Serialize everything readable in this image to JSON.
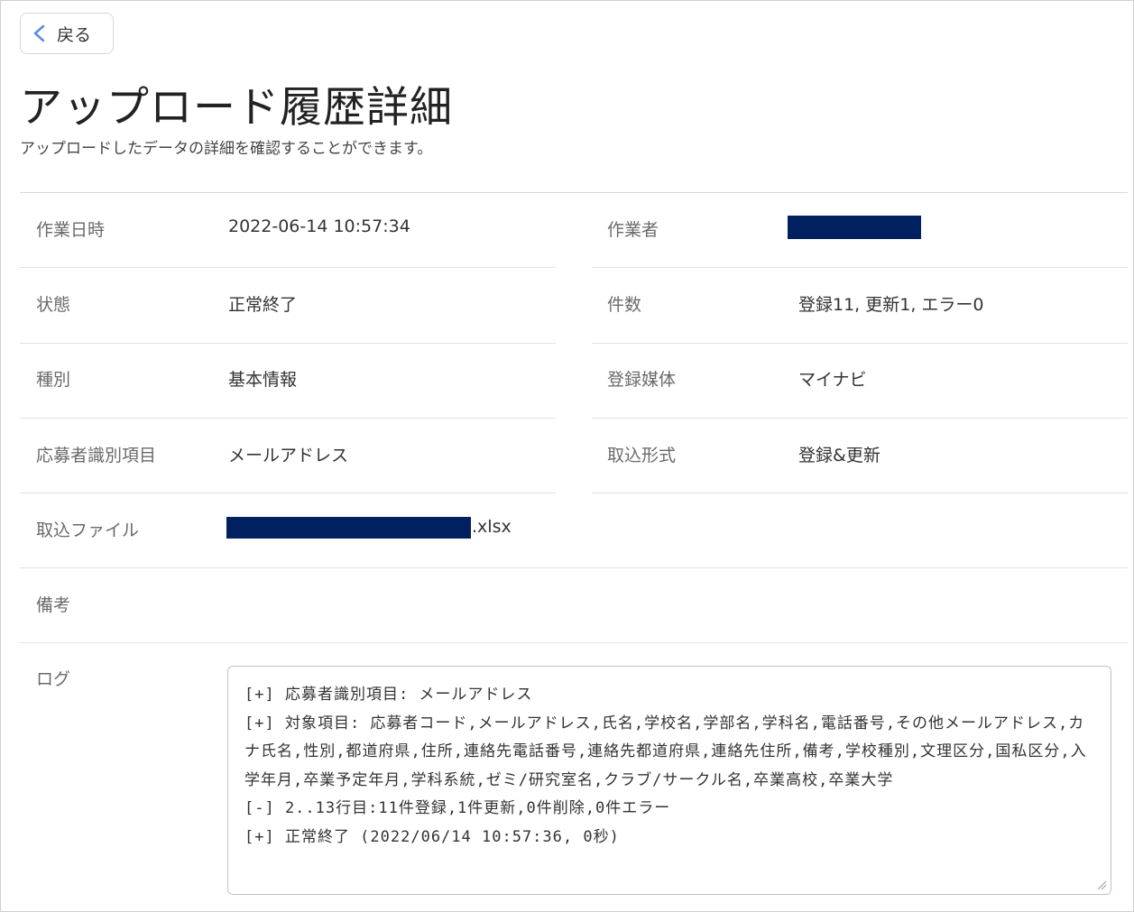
{
  "back_button": {
    "label": "戻る",
    "icon": "chevron-left-icon"
  },
  "header": {
    "title": "アップロード履歴詳細",
    "subtitle": "アップロードしたデータの詳細を確認することができます。"
  },
  "details": {
    "work_datetime": {
      "label": "作業日時",
      "value": "2022-06-14 10:57:34"
    },
    "operator": {
      "label": "作業者",
      "value_redacted": true
    },
    "status": {
      "label": "状態",
      "value": "正常終了"
    },
    "count": {
      "label": "件数",
      "value": "登録11, 更新1, エラー0"
    },
    "type": {
      "label": "種別",
      "value": "基本情報"
    },
    "media": {
      "label": "登録媒体",
      "value": "マイナビ"
    },
    "applicant_id_item": {
      "label": "応募者識別項目",
      "value": "メールアドレス"
    },
    "import_format": {
      "label": "取込形式",
      "value": "登録&更新"
    },
    "import_file": {
      "label": "取込ファイル",
      "value_suffix": ".xlsx",
      "name_redacted": true
    },
    "remarks": {
      "label": "備考",
      "value": ""
    },
    "log": {
      "label": "ログ",
      "lines": [
        "[+] 応募者識別項目: メールアドレス",
        "[+] 対象項目: 応募者コード,メールアドレス,氏名,学校名,学部名,学科名,電話番号,その他メールアドレス,カナ氏名,性別,都道府県,住所,連絡先電話番号,連絡先都道府県,連絡先住所,備考,学校種別,文理区分,国私区分,入学年月,卒業予定年月,学科系統,ゼミ/研究室名,クラブ/サークル名,卒業高校,卒業大学",
        "[-] 2..13行目:11件登録,1件更新,0件削除,0件エラー",
        "[+] 正常終了 (2022/06/14 10:57:36, 0秒)"
      ]
    }
  },
  "colors": {
    "redaction": "#002060",
    "label": "#6a6a6a",
    "divider": "#e2e2e2"
  }
}
